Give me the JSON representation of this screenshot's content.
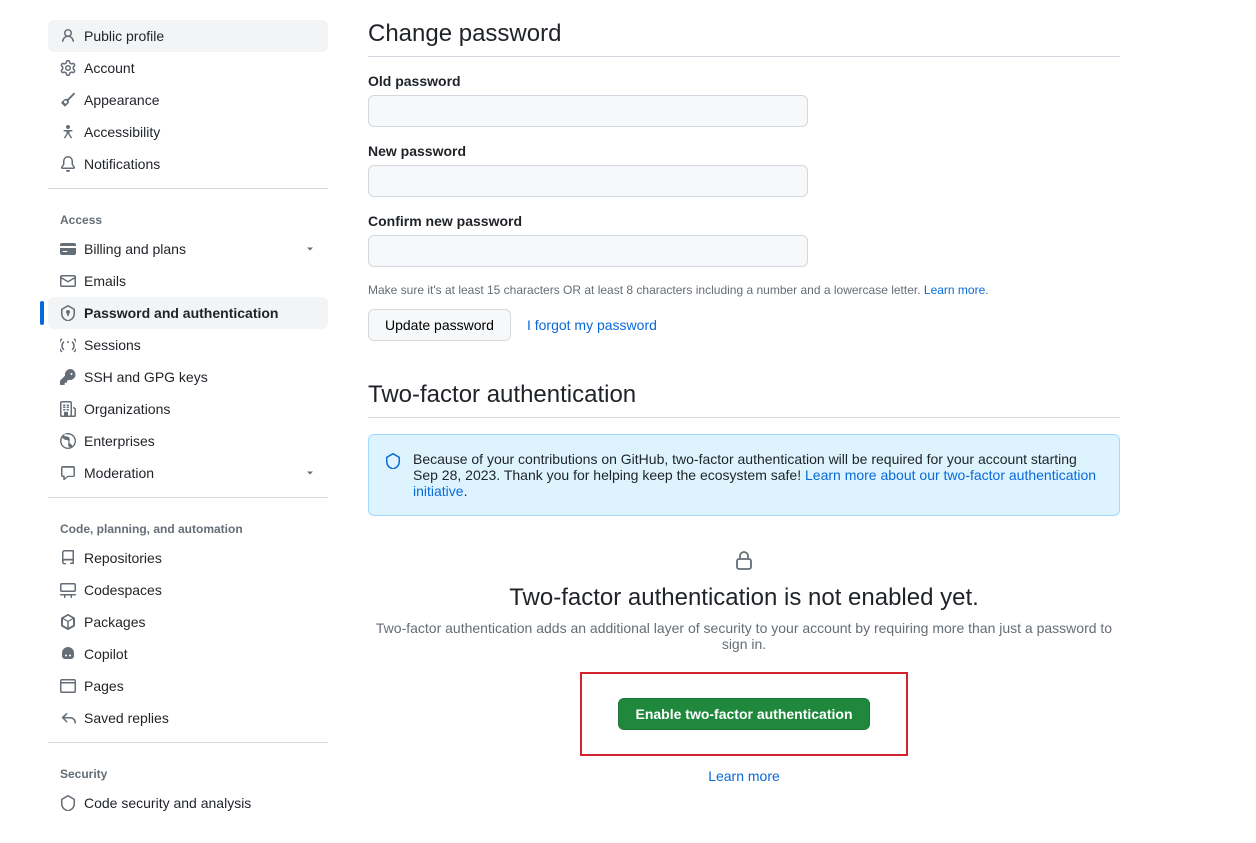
{
  "sidebar": {
    "section1": {
      "items": [
        {
          "label": "Public profile"
        },
        {
          "label": "Account"
        },
        {
          "label": "Appearance"
        },
        {
          "label": "Accessibility"
        },
        {
          "label": "Notifications"
        }
      ]
    },
    "section2": {
      "title": "Access",
      "items": [
        {
          "label": "Billing and plans"
        },
        {
          "label": "Emails"
        },
        {
          "label": "Password and authentication"
        },
        {
          "label": "Sessions"
        },
        {
          "label": "SSH and GPG keys"
        },
        {
          "label": "Organizations"
        },
        {
          "label": "Enterprises"
        },
        {
          "label": "Moderation"
        }
      ]
    },
    "section3": {
      "title": "Code, planning, and automation",
      "items": [
        {
          "label": "Repositories"
        },
        {
          "label": "Codespaces"
        },
        {
          "label": "Packages"
        },
        {
          "label": "Copilot"
        },
        {
          "label": "Pages"
        },
        {
          "label": "Saved replies"
        }
      ]
    },
    "section4": {
      "title": "Security",
      "items": [
        {
          "label": "Code security and analysis"
        }
      ]
    }
  },
  "main": {
    "change_password_title": "Change password",
    "old_password_label": "Old password",
    "new_password_label": "New password",
    "confirm_password_label": "Confirm new password",
    "password_hint_pre": "Make sure it's at least 15 characters OR at least 8 characters including a number and a lowercase letter. ",
    "password_hint_link": "Learn more",
    "update_password_btn": "Update password",
    "forgot_link": "I forgot my password",
    "tfa_heading": "Two-factor authentication",
    "banner_text": "Because of your contributions on GitHub, two-factor authentication will be required for your account starting Sep 28, 2023. Thank you for helping keep the ecosystem safe! ",
    "banner_link": "Learn more about our two-factor authentication initiative",
    "tfa_not_enabled_title": "Two-factor authentication is not enabled yet.",
    "tfa_subtitle": "Two-factor authentication adds an additional layer of security to your account by requiring more than just a password to sign in.",
    "enable_tfa_btn": "Enable two-factor authentication",
    "tfa_learn_more": "Learn more"
  }
}
